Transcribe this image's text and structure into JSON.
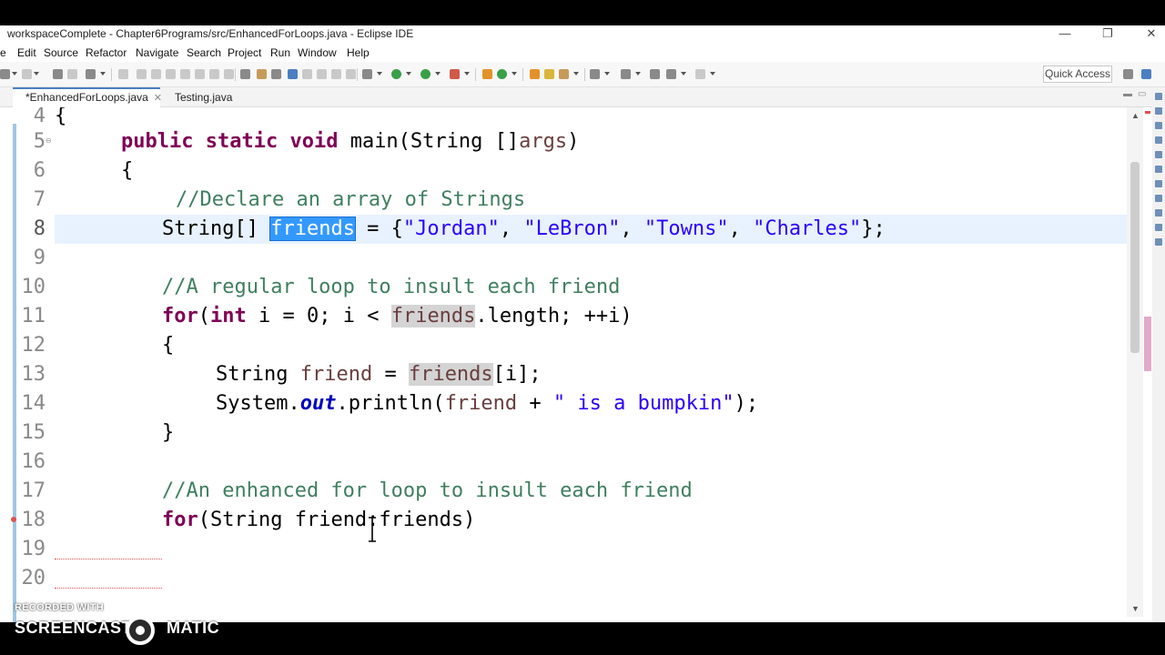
{
  "window": {
    "title": "workspaceComplete - Chapter6Programs/src/EnhancedForLoops.java - Eclipse IDE",
    "minimize_glyph": "—",
    "restore_glyph": "❐",
    "close_glyph": "✕"
  },
  "menu": [
    "File",
    "Edit",
    "Source",
    "Refactor",
    "Navigate",
    "Search",
    "Project",
    "Run",
    "Window",
    "Help"
  ],
  "menu_first_fragment": "e",
  "toolbar": {
    "quick_access": "Quick Access"
  },
  "tabs": [
    {
      "label": "*EnhancedForLoops.java",
      "active": true,
      "close": "✕"
    },
    {
      "label": "Testing.java",
      "active": false
    }
  ],
  "editor": {
    "line_numbers": [
      "4",
      "5",
      "6",
      "7",
      "8",
      "9",
      "10",
      "11",
      "12",
      "13",
      "14",
      "15",
      "16",
      "17",
      "18",
      "19",
      "20"
    ],
    "line4_text": "{",
    "line5": {
      "kw1": "public",
      "kw2": "static",
      "kw3": "void",
      "rest": " main(String []",
      "param": "args",
      "close": ")"
    },
    "line6_text": "{",
    "line7_comment": "//Declare an array of Strings",
    "line8": {
      "type": "String[] ",
      "selected": "friends",
      "eq": " = {",
      "s1": "\"Jordan\"",
      "c1": ", ",
      "s2": "\"LeBron\"",
      "c2": ", ",
      "s3": "\"Towns\"",
      "c3": ", ",
      "s4": "\"Charles\"",
      "end": "};"
    },
    "line10_comment": "//A regular loop to insult each friend",
    "line11": {
      "kw_for": "for",
      "open": "(",
      "kw_int": "int",
      "a": " i = 0; i < ",
      "arr": "friends",
      "b": ".length; ++i)"
    },
    "line12_text": "{",
    "line13": {
      "type": "String ",
      "var": "friend",
      "eq": " = ",
      "arr": "friends",
      "idx": "[i];"
    },
    "line14": {
      "a": "System.",
      "field": "out",
      "b": ".println(",
      "var": "friend",
      "c": " + ",
      "str": "\" is a bumpkin\"",
      "d": ");"
    },
    "line15_text": "}",
    "line17_comment": "//An enhanced for loop to insult each friend",
    "line18": {
      "kw_for": "for",
      "rest": "(String friend:friends)"
    }
  },
  "watermark": {
    "top": "RECORDED WITH",
    "left": "SCREENCAST",
    "right": "MATIC"
  }
}
